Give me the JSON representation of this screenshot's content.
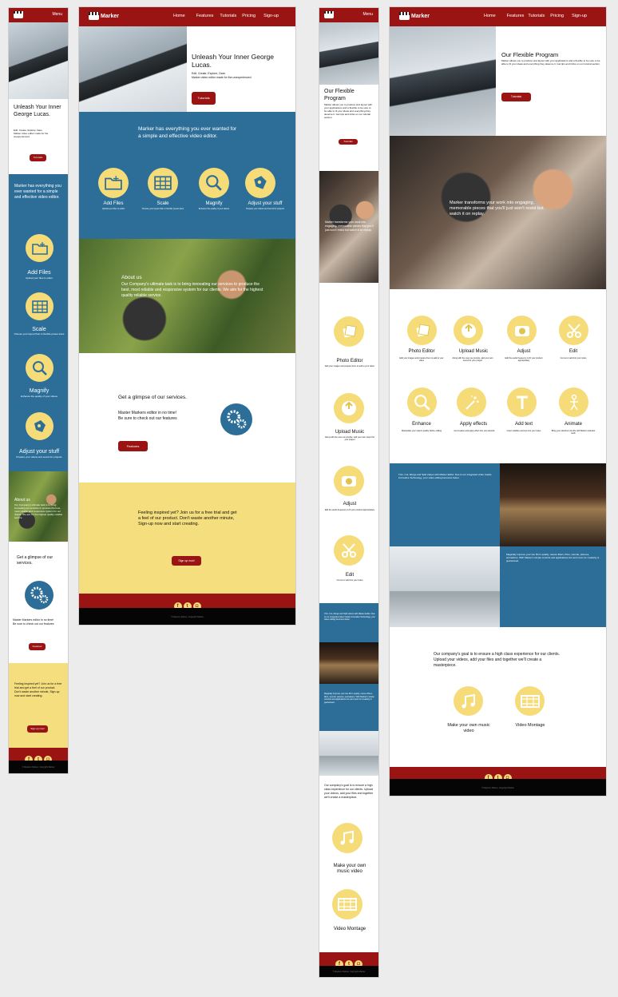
{
  "brand": "Marker",
  "nav": [
    "Home",
    "Features",
    "Tutorials",
    "Pricing",
    "Sign-up"
  ],
  "menu": "Menu",
  "home": {
    "hero_title": "Unleash Your Inner George Lucas.",
    "hero_sub1": "Edit, Create, Explore, Dare.",
    "hero_sub2": "Marker video editor made for the unexperienced",
    "hero_btn": "Tutorials",
    "intro": "Marker has everything you ever wanted for a simple and effective video editor.",
    "features": [
      {
        "title": "Add Files",
        "desc": "Upload your files to editor",
        "icon": "folder-plus-icon"
      },
      {
        "title": "Scale",
        "desc": "Choose your layout Pain in flexible preset sizes",
        "icon": "grid-icon"
      },
      {
        "title": "Magnify",
        "desc": "Enhance the quality of your videos",
        "icon": "magnify-icon"
      },
      {
        "title": "Adjust your stuff",
        "desc": "Prepare your videos and sound for projects",
        "icon": "adjust-icon"
      }
    ],
    "about_title": "About us",
    "about_text": "Our Company's ultimate task is to bring innovating our services to produce the best, most reliable and responsive system for our clients. We aim for the highest quality reliable service.",
    "services_title": "Get a glimpse of our services.",
    "services_text1": "Master Markers editor in no time!",
    "services_text2": "Be sure to check out our features",
    "services_btn": "Features",
    "cta_text": "Feeling inspired yet? Join us for a free trial and get a feel of our product. Don't waste another minute, Sign-up now and start creating.",
    "cta_btn": "Sign up now!",
    "copyright": "© Mayhem Marker, Copyright Marker"
  },
  "features_page": {
    "title": "Our Flexible Program",
    "sub": "Marker allows you to produce and layout with your applications and a flexible to be sure to be able to fit your ideas and everything they deserve it. Get tips and tricks on our tutorial section.",
    "btn": "Tutorials",
    "crew_text": "Marker transforms your work into engaging, memorable pieces that you'll just won't resist but watch it on replay.",
    "tools": [
      {
        "title": "Photo Editor",
        "desc": "Edit your images and prepare them to add to your video",
        "icon": "photos-icon"
      },
      {
        "title": "Upload Music",
        "desc": "Along with the ones we provide, add your own sound for your project",
        "icon": "upload-music-icon"
      },
      {
        "title": "Adjust",
        "desc": "Edit the audio frequency to fit your product appropriately",
        "icon": "camera-icon"
      },
      {
        "title": "Edit",
        "desc": "Cut out or add into your video",
        "icon": "scissors-icon"
      },
      {
        "title": "Enhance",
        "desc": "Manipulate your video's quality before editing",
        "icon": "magnify-icon"
      },
      {
        "title": "Apply effects",
        "desc": "Get creative and apply effect into your artwork",
        "icon": "wand-icon"
      },
      {
        "title": "Add text",
        "desc": "Insert subtitles and text into your video",
        "icon": "text-icon"
      },
      {
        "title": "Animate",
        "desc": "Bring your sketches into life with Marker animator tools",
        "icon": "stickman-icon"
      }
    ],
    "studio_text": "Trim, Cut, Merge and Split videos with Marker Editor. Due to our integrated video Castle innovative Technology, your video editing becomes faster.",
    "glasses_text": "Magically improve your two film's quality, reduce filters, films, sounds, pictures, animations. With Marker's simple controls and applications fun and room for creativity is guaranteed.",
    "goal_text": "Our company's goal is to ensure a high class experience for our clients. Upload your videos, add your files and together we'll create a masterpiece.",
    "services": [
      {
        "title": "Make your own music video",
        "icon": "music-notes-icon"
      },
      {
        "title": "Video Montage",
        "icon": "film-icon"
      }
    ],
    "copyright": "© Mayhem Marker, Copyright Marker"
  },
  "colors": {
    "primary": "#9a1414",
    "blue": "#2c6e98",
    "yellow": "#f4de7e",
    "icon_bg": "#f5dc78"
  }
}
